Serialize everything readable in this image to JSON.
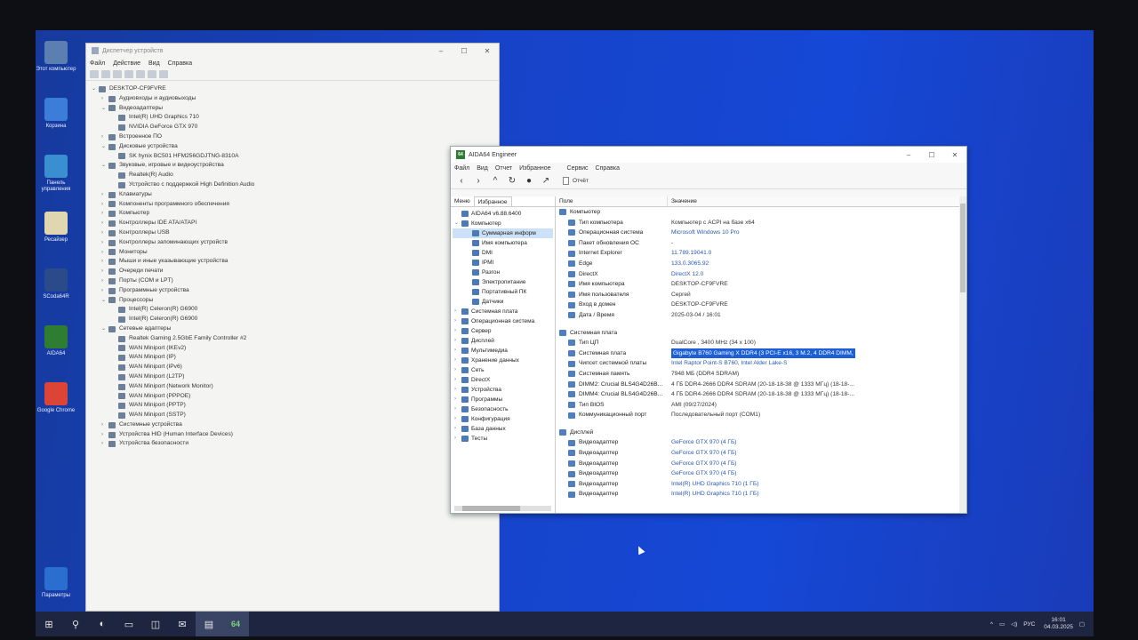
{
  "desktop_icons": [
    {
      "label": "Этот компьютер",
      "icon": "computer-icon",
      "color": "#5a7fb0"
    },
    {
      "label": "Корзина",
      "icon": "recycle-bin-icon",
      "color": "#3b7dd8"
    },
    {
      "label": "Панель управления",
      "icon": "control-panel-icon",
      "color": "#3a8fd0"
    },
    {
      "label": "Ресайзер",
      "icon": "file-icon",
      "color": "#e0d7b0"
    },
    {
      "label": "SCoda64R",
      "icon": "program-icon",
      "color": "#2a4a8a"
    },
    {
      "label": "AIDA64",
      "icon": "aida64-icon",
      "color": "#2e7d32"
    },
    {
      "label": "Google Chrome",
      "icon": "chrome-icon",
      "color": "#db4437"
    },
    {
      "label": "Параметры",
      "icon": "settings-gear-icon",
      "color": "#2a6fd0"
    }
  ],
  "devmgr": {
    "title": "Диспетчер устройств",
    "menu": [
      "Файл",
      "Действие",
      "Вид",
      "Справка"
    ],
    "tree": [
      {
        "label": "DESKTOP-CF9FVRE",
        "level": 0,
        "toggle": "v"
      },
      {
        "label": "Аудиовходы и аудиовыходы",
        "level": 1,
        "toggle": ">"
      },
      {
        "label": "Видеоадаптеры",
        "level": 1,
        "toggle": "v"
      },
      {
        "label": "Intel(R) UHD Graphics 710",
        "level": 2,
        "toggle": ""
      },
      {
        "label": "NVIDIA GeForce GTX 970",
        "level": 2,
        "toggle": ""
      },
      {
        "label": "Встроенное ПО",
        "level": 1,
        "toggle": ">"
      },
      {
        "label": "Дисковые устройства",
        "level": 1,
        "toggle": "v"
      },
      {
        "label": "SK hynix BC501 HFM256GDJTNG-8310A",
        "level": 2,
        "toggle": ""
      },
      {
        "label": "Звуковые, игровые и видеоустройства",
        "level": 1,
        "toggle": "v"
      },
      {
        "label": "Realtek(R) Audio",
        "level": 2,
        "toggle": ""
      },
      {
        "label": "Устройство с поддержкой High Definition Audio",
        "level": 2,
        "toggle": ""
      },
      {
        "label": "Клавиатуры",
        "level": 1,
        "toggle": ">"
      },
      {
        "label": "Компоненты программного обеспечения",
        "level": 1,
        "toggle": ">"
      },
      {
        "label": "Компьютер",
        "level": 1,
        "toggle": ">"
      },
      {
        "label": "Контроллеры IDE ATA/ATAPI",
        "level": 1,
        "toggle": ">"
      },
      {
        "label": "Контроллеры USB",
        "level": 1,
        "toggle": ">"
      },
      {
        "label": "Контроллеры запоминающих устройств",
        "level": 1,
        "toggle": ">"
      },
      {
        "label": "Мониторы",
        "level": 1,
        "toggle": ">"
      },
      {
        "label": "Мыши и иные указывающие устройства",
        "level": 1,
        "toggle": ">"
      },
      {
        "label": "Очереди печати",
        "level": 1,
        "toggle": ">"
      },
      {
        "label": "Порты (COM и LPT)",
        "level": 1,
        "toggle": ">"
      },
      {
        "label": "Программные устройства",
        "level": 1,
        "toggle": ">"
      },
      {
        "label": "Процессоры",
        "level": 1,
        "toggle": "v"
      },
      {
        "label": "Intel(R) Celeron(R) G6900",
        "level": 2,
        "toggle": ""
      },
      {
        "label": "Intel(R) Celeron(R) G6900",
        "level": 2,
        "toggle": ""
      },
      {
        "label": "Сетевые адаптеры",
        "level": 1,
        "toggle": "v"
      },
      {
        "label": "Realtek Gaming 2.5GbE Family Controller #2",
        "level": 2,
        "toggle": ""
      },
      {
        "label": "WAN Miniport (IKEv2)",
        "level": 2,
        "toggle": ""
      },
      {
        "label": "WAN Miniport (IP)",
        "level": 2,
        "toggle": ""
      },
      {
        "label": "WAN Miniport (IPv6)",
        "level": 2,
        "toggle": ""
      },
      {
        "label": "WAN Miniport (L2TP)",
        "level": 2,
        "toggle": ""
      },
      {
        "label": "WAN Miniport (Network Monitor)",
        "level": 2,
        "toggle": ""
      },
      {
        "label": "WAN Miniport (PPPOE)",
        "level": 2,
        "toggle": ""
      },
      {
        "label": "WAN Miniport (PPTP)",
        "level": 2,
        "toggle": ""
      },
      {
        "label": "WAN Miniport (SSTP)",
        "level": 2,
        "toggle": ""
      },
      {
        "label": "Системные устройства",
        "level": 1,
        "toggle": ">"
      },
      {
        "label": "Устройства HID (Human Interface Devices)",
        "level": 1,
        "toggle": ">"
      },
      {
        "label": "Устройства безопасности",
        "level": 1,
        "toggle": ">"
      }
    ]
  },
  "aida": {
    "title": "AIDA64 Engineer",
    "logo": "64",
    "menu": [
      "Файл",
      "Вид",
      "Отчет",
      "Избранное",
      "Сервис",
      "Справка"
    ],
    "report_label": "Отчёт",
    "tabs": [
      "Меню",
      "Избранное"
    ],
    "left_tree": [
      {
        "label": "AIDA64 v6.88.6400",
        "level": 0,
        "toggle": ""
      },
      {
        "label": "Компьютер",
        "level": 0,
        "toggle": "v"
      },
      {
        "label": "Суммарная информ",
        "level": 1,
        "toggle": "",
        "selected": true
      },
      {
        "label": "Имя компьютера",
        "level": 1,
        "toggle": ""
      },
      {
        "label": "DMI",
        "level": 1,
        "toggle": ""
      },
      {
        "label": "IPMI",
        "level": 1,
        "toggle": ""
      },
      {
        "label": "Разгон",
        "level": 1,
        "toggle": ""
      },
      {
        "label": "Электропитание",
        "level": 1,
        "toggle": ""
      },
      {
        "label": "Портативный ПК",
        "level": 1,
        "toggle": ""
      },
      {
        "label": "Датчики",
        "level": 1,
        "toggle": ""
      },
      {
        "label": "Системная плата",
        "level": 0,
        "toggle": ">"
      },
      {
        "label": "Операционная система",
        "level": 0,
        "toggle": ">"
      },
      {
        "label": "Сервер",
        "level": 0,
        "toggle": ">"
      },
      {
        "label": "Дисплей",
        "level": 0,
        "toggle": ">"
      },
      {
        "label": "Мультимедиа",
        "level": 0,
        "toggle": ">"
      },
      {
        "label": "Хранение данных",
        "level": 0,
        "toggle": ">"
      },
      {
        "label": "Сеть",
        "level": 0,
        "toggle": ">"
      },
      {
        "label": "DirectX",
        "level": 0,
        "toggle": ">"
      },
      {
        "label": "Устройства",
        "level": 0,
        "toggle": ">"
      },
      {
        "label": "Программы",
        "level": 0,
        "toggle": ">"
      },
      {
        "label": "Безопасность",
        "level": 0,
        "toggle": ">"
      },
      {
        "label": "Конфигурация",
        "level": 0,
        "toggle": ">"
      },
      {
        "label": "База данных",
        "level": 0,
        "toggle": ">"
      },
      {
        "label": "Тесты",
        "level": 0,
        "toggle": ">"
      }
    ],
    "columns": [
      "Поле",
      "Значение"
    ],
    "sections": [
      {
        "title": "Компьютер",
        "rows": [
          {
            "field": "Тип компьютера",
            "value": "Компьютер с ACPI на базе x64"
          },
          {
            "field": "Операционная система",
            "value": "Microsoft Windows 10 Pro",
            "link": true
          },
          {
            "field": "Пакет обновления ОС",
            "value": "-"
          },
          {
            "field": "Internet Explorer",
            "value": "11.789.19041.0",
            "link": true
          },
          {
            "field": "Edge",
            "value": "133.0.3065.92",
            "link": true
          },
          {
            "field": "DirectX",
            "value": "DirectX 12.0",
            "link": true
          },
          {
            "field": "Имя компьютера",
            "value": "DESKTOP-CF9FVRE"
          },
          {
            "field": "Имя пользователя",
            "value": "Сергей"
          },
          {
            "field": "Вход в домен",
            "value": "DESKTOP-CF9FVRE"
          },
          {
            "field": "Дата / Время",
            "value": "2025-03-04 / 16:01"
          }
        ]
      },
      {
        "title": "Системная плата",
        "rows": [
          {
            "field": "Тип ЦП",
            "value": "DualCore , 3400 MHz (34 x 100)"
          },
          {
            "field": "Системная плата",
            "value": "Gigabyte B760 Gaming X DDR4 (3 PCI-E x16, 3 M.2, 4 DDR4 DIMM,",
            "selected": true
          },
          {
            "field": "Чипсет системной платы",
            "value": "Intel Raptor Point-S B760, Intel Alder Lake-S",
            "link": true
          },
          {
            "field": "Системная память",
            "value": "7948 МБ (DDR4 SDRAM)"
          },
          {
            "field": "DIMM2: Crucial BLS4G4D26B...",
            "value": "4 ГБ DDR4-2666 DDR4 SDRAM (20-18-18-38 @ 1333 МГц) (18-18-..."
          },
          {
            "field": "DIMM4: Crucial BLS4G4D26B...",
            "value": "4 ГБ DDR4-2666 DDR4 SDRAM (20-18-18-38 @ 1333 МГц) (18-18-..."
          },
          {
            "field": "Тип BIOS",
            "value": "AMI (09/27/2024)"
          },
          {
            "field": "Коммуникационный порт",
            "value": "Последовательный порт (COM1)"
          }
        ]
      },
      {
        "title": "Дисплей",
        "rows": [
          {
            "field": "Видеоадаптер",
            "value": "GeForce GTX 970  (4 ГБ)",
            "link": true
          },
          {
            "field": "Видеоадаптер",
            "value": "GeForce GTX 970  (4 ГБ)",
            "link": true
          },
          {
            "field": "Видеоадаптер",
            "value": "GeForce GTX 970  (4 ГБ)",
            "link": true
          },
          {
            "field": "Видеоадаптер",
            "value": "GeForce GTX 970  (4 ГБ)",
            "link": true
          },
          {
            "field": "Видеоадаптер",
            "value": "Intel(R) UHD Graphics 710  (1 ГБ)",
            "link": true
          },
          {
            "field": "Видеоадаптер",
            "value": "Intel(R) UHD Graphics 710  (1 ГБ)",
            "link": true
          }
        ]
      }
    ]
  },
  "taskbar": {
    "items": [
      {
        "icon": "windows-start-icon",
        "glyph": "⊞"
      },
      {
        "icon": "search-icon",
        "glyph": "⚲"
      },
      {
        "icon": "edge-icon",
        "glyph": "◐"
      },
      {
        "icon": "file-explorer-icon",
        "glyph": "▭"
      },
      {
        "icon": "store-icon",
        "glyph": "◫"
      },
      {
        "icon": "mail-icon",
        "glyph": "✉"
      },
      {
        "icon": "device-manager-icon",
        "glyph": "▤"
      },
      {
        "icon": "aida64-taskbar-icon",
        "glyph": "64"
      }
    ],
    "lang": "РУС",
    "time": "16:01",
    "date": "04.03.2025"
  }
}
